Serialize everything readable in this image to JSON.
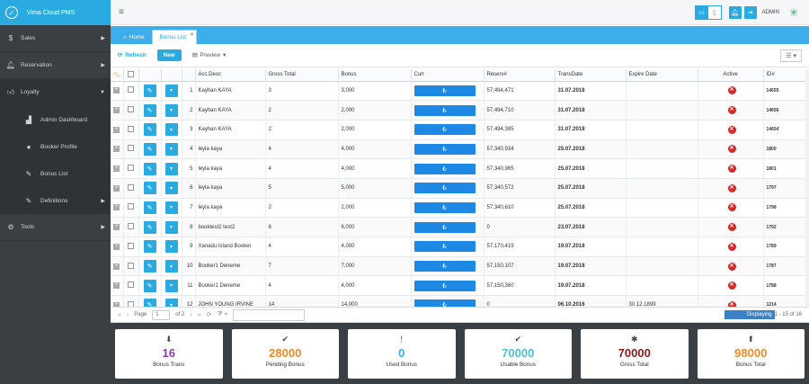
{
  "app": {
    "title": "Vima Cloud PMS",
    "admin": "ADMIN"
  },
  "sidebar": {
    "items": [
      {
        "label": "Sales",
        "icon": "dollar-icon"
      },
      {
        "label": "Reservation",
        "icon": "bell-icon"
      },
      {
        "label": "Loyalty",
        "icon": "thumbs-up-icon"
      },
      {
        "label": "Admin Dashboard",
        "icon": "chart-icon"
      },
      {
        "label": "Booker Profile",
        "icon": "user-icon"
      },
      {
        "label": "Bonus List",
        "icon": "edit-icon"
      },
      {
        "label": "Definitions",
        "icon": "edit-icon"
      },
      {
        "label": "Tools",
        "icon": "gears-icon"
      }
    ]
  },
  "tabs": {
    "home": "Home",
    "bonus_list": "Bonus List"
  },
  "toolbar": {
    "refresh": "Refresh",
    "new": "New",
    "preview": "Preview"
  },
  "grid": {
    "columns": [
      "Acc.Desc",
      "Gross Total",
      "Bonus",
      "Curr",
      "Reserv#",
      "TransDate",
      "Expire Date",
      "Active",
      "ID#"
    ],
    "rows": [
      {
        "n": "1",
        "desc": "Kayhan KAYA",
        "gross": "3",
        "bonus": "3,000",
        "curr": "₺",
        "reserv": "57,494,471",
        "trans": "31.07.2018",
        "expire": "",
        "id": "14655"
      },
      {
        "n": "2",
        "desc": "Kayhan KAYA",
        "gross": "2",
        "bonus": "2,000",
        "curr": "₺",
        "reserv": "57,494,710",
        "trans": "31.07.2018",
        "expire": "",
        "id": "14656"
      },
      {
        "n": "3",
        "desc": "Kayhan KAYA",
        "gross": "2",
        "bonus": "2,000",
        "curr": "₺",
        "reserv": "57,494,385",
        "trans": "31.07.2018",
        "expire": "",
        "id": "14654"
      },
      {
        "n": "4",
        "desc": "leyla kaya",
        "gross": "4",
        "bonus": "4,000",
        "curr": "₺",
        "reserv": "57,340,934",
        "trans": "25.07.2018",
        "expire": "",
        "id": "1800"
      },
      {
        "n": "5",
        "desc": "leyla kaya",
        "gross": "4",
        "bonus": "4,000",
        "curr": "₺",
        "reserv": "57,340,965",
        "trans": "25.07.2018",
        "expire": "",
        "id": "1801"
      },
      {
        "n": "6",
        "desc": "leyla kaya",
        "gross": "5",
        "bonus": "5,000",
        "curr": "₺",
        "reserv": "57,340,572",
        "trans": "25.07.2018",
        "expire": "",
        "id": "1797"
      },
      {
        "n": "7",
        "desc": "leyla kaya",
        "gross": "2",
        "bonus": "2,000",
        "curr": "₺",
        "reserv": "57,340,610",
        "trans": "25.07.2018",
        "expire": "",
        "id": "1798"
      },
      {
        "n": "8",
        "desc": "booktest2 test2",
        "gross": "6",
        "bonus": "6,000",
        "curr": "₺",
        "reserv": "0",
        "trans": "23.07.2018",
        "expire": "",
        "id": "1792"
      },
      {
        "n": "9",
        "desc": "Xanadu Island Booker",
        "gross": "4",
        "bonus": "4,000",
        "curr": "₺",
        "reserv": "57,170,419",
        "trans": "19.07.2018",
        "expire": "",
        "id": "1789"
      },
      {
        "n": "10",
        "desc": "Booker1 Deneme",
        "gross": "7",
        "bonus": "7,000",
        "curr": "₺",
        "reserv": "57,150,107",
        "trans": "19.07.2018",
        "expire": "",
        "id": "1787"
      },
      {
        "n": "11",
        "desc": "Booker1 Deneme",
        "gross": "4",
        "bonus": "4,000",
        "curr": "₺",
        "reserv": "57,150,360",
        "trans": "19.07.2018",
        "expire": "",
        "id": "1788"
      },
      {
        "n": "12",
        "desc": "JOHN YOUNG IRVINE",
        "gross": "14",
        "bonus": "14,000",
        "curr": "₺",
        "reserv": "0",
        "trans": "06.10.2016",
        "expire": "30.12.1899",
        "id": "1214"
      }
    ]
  },
  "pager": {
    "page_label": "Page",
    "page": "1",
    "of": "of 2",
    "status": "Displaying 1 - 15 of 16",
    "status_bar": "Displaying",
    "status_rest": " 1 - 15 of 16"
  },
  "cards": [
    {
      "value": "16",
      "label": "Bonus Trans",
      "color": "#8e3aa6",
      "icon": "arrow-down-circle-icon",
      "glyph": "⬇"
    },
    {
      "value": "28000",
      "label": "Pending Bonus",
      "color": "#f08a24",
      "icon": "check-icon",
      "glyph": "✔"
    },
    {
      "value": "0",
      "label": "Used Bonus",
      "color": "#39b0e5",
      "icon": "exclamation-icon",
      "glyph": "!"
    },
    {
      "value": "70000",
      "label": "Usable Bonus",
      "color": "#4fc3c9",
      "icon": "check-icon",
      "glyph": "✔"
    },
    {
      "value": "70000",
      "label": "Gross Total",
      "color": "#8b1a1a",
      "icon": "asterisk-icon",
      "glyph": "✱"
    },
    {
      "value": "98000",
      "label": "Bonus Total",
      "color": "#f08a24",
      "icon": "arrow-up-circle-icon",
      "glyph": "⬆"
    }
  ]
}
